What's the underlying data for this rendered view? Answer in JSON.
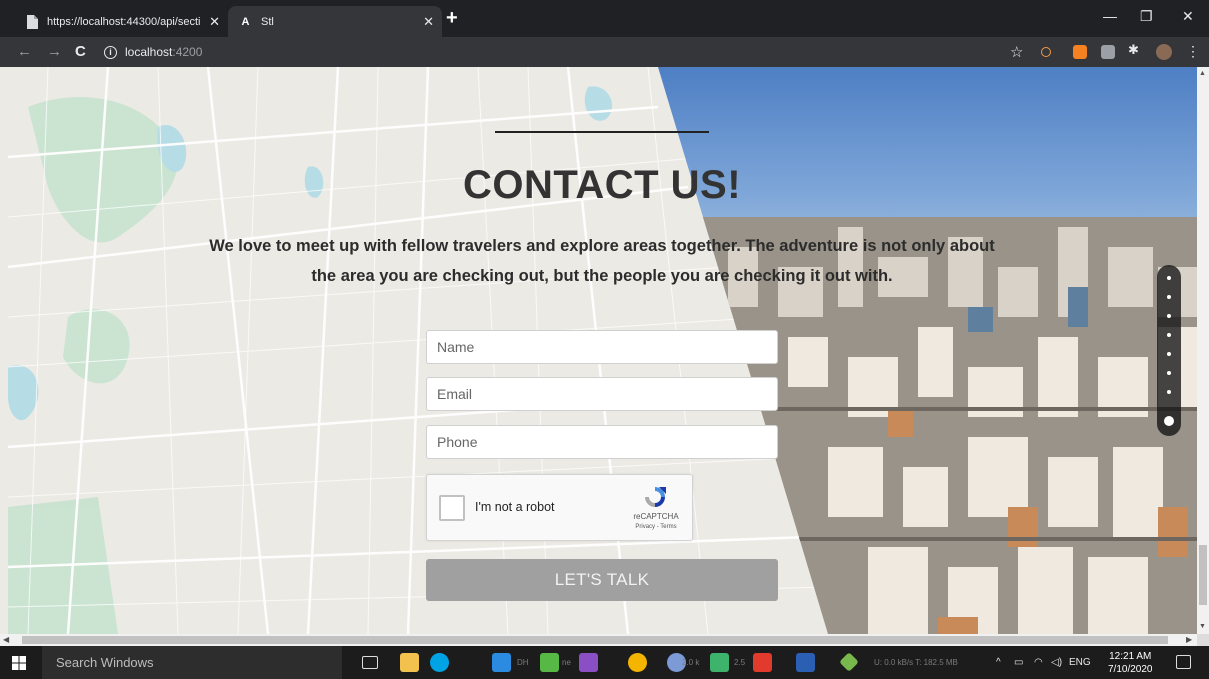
{
  "browser": {
    "tabs": [
      {
        "title": "https://localhost:44300/api/secti",
        "active": false
      },
      {
        "title": "Stl",
        "active": true
      }
    ],
    "url_host": "localhost",
    "url_port": ":4200"
  },
  "page": {
    "title": "CONTACT US!",
    "intro": "We love to meet up with fellow travelers and explore areas together. The adventure is not only about the area you are checking out, but the people you are checking it out with.",
    "form": {
      "name_placeholder": "Name",
      "email_placeholder": "Email",
      "phone_placeholder": "Phone",
      "captcha_label": "I'm not a robot",
      "captcha_brand": "reCAPTCHA",
      "captcha_terms": "Privacy - Terms",
      "submit_label": "LET'S TALK"
    },
    "section_nav": {
      "count": 8,
      "active_index": 7
    }
  },
  "taskbar": {
    "search_placeholder": "Search Windows",
    "net_dh": "DH",
    "net_ne": "ne",
    "net_speed_a": "2.0 k",
    "net_speed_b": "2.5",
    "net_stats": "U: 0.0 kB/s T: 182.5 MB",
    "language": "ENG",
    "time": "12:21 AM",
    "date": "7/10/2020"
  },
  "colors": {
    "chrome_dark": "#202124",
    "chrome_toolbar": "#35363a",
    "button_gray": "#a0a0a0",
    "map_bg": "#eceae4",
    "sky_blue": "#4e7fc4"
  }
}
